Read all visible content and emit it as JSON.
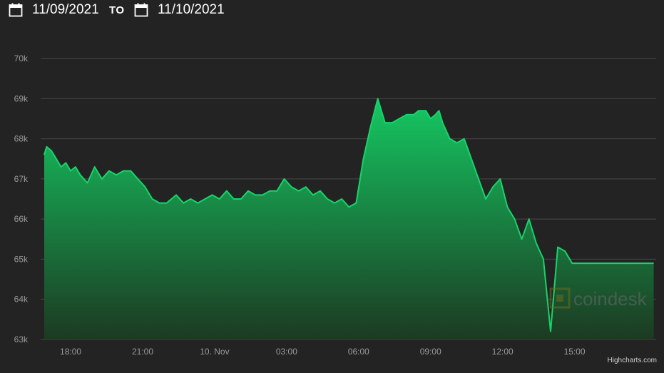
{
  "range": {
    "from": "11/09/2021",
    "separator": "TO",
    "to": "11/10/2021"
  },
  "icons": {
    "calendar": "calendar-icon"
  },
  "colors": {
    "background": "#232323",
    "line": "#18d46a",
    "fill_top": "#15c862",
    "fill_bottom": "#1c3a22",
    "grid": "#4a4a4a",
    "tick": "#9a9a9a",
    "watermark": "#5a5a1a"
  },
  "watermark": "coindesk",
  "credits": "Highcharts.com",
  "chart_data": {
    "type": "area",
    "title": "",
    "xlabel": "",
    "ylabel": "",
    "ylim": [
      63000,
      70000
    ],
    "yticks": [
      63000,
      64000,
      65000,
      66000,
      67000,
      68000,
      69000,
      70000
    ],
    "ytick_labels": [
      "63k",
      "64k",
      "65k",
      "66k",
      "67k",
      "68k",
      "69k",
      "70k"
    ],
    "xticks": [
      18,
      21,
      24,
      27,
      30,
      33,
      36,
      39
    ],
    "xtick_labels": [
      "18:00",
      "21:00",
      "10. Nov",
      "03:00",
      "06:00",
      "09:00",
      "12:00",
      "15:00"
    ],
    "grid": true,
    "legend": "none",
    "series": [
      {
        "x": [
          16.9,
          17.0,
          17.2,
          17.4,
          17.6,
          17.8,
          18.0,
          18.2,
          18.4,
          18.7,
          19.0,
          19.3,
          19.6,
          19.9,
          20.2,
          20.5,
          20.8,
          21.1,
          21.4,
          21.7,
          22.0,
          22.2,
          22.4,
          22.7,
          23.0,
          23.3,
          23.6,
          23.9,
          24.2,
          24.5,
          24.8,
          25.1,
          25.4,
          25.7,
          26.0,
          26.3,
          26.6,
          26.9,
          27.2,
          27.5,
          27.8,
          28.1,
          28.4,
          28.7,
          29.0,
          29.3,
          29.6,
          29.9,
          30.2,
          30.5,
          30.8,
          31.1,
          31.4,
          31.7,
          32.0,
          32.3,
          32.5,
          32.8,
          33.0,
          33.2,
          33.35,
          33.5,
          33.8,
          34.1,
          34.4,
          34.7,
          35.0,
          35.3,
          35.6,
          35.9,
          36.2,
          36.5,
          36.8,
          37.1,
          37.4,
          37.7,
          38.0,
          38.3,
          38.6,
          38.9,
          39.2,
          39.5,
          39.8,
          40.0,
          40.2,
          40.4,
          40.6,
          40.8,
          41.0,
          41.1,
          41.2,
          41.4,
          41.5,
          41.6,
          41.7,
          41.8,
          42.0,
          42.2,
          42.3
        ],
        "y": [
          67600,
          67800,
          67700,
          67500,
          67300,
          67400,
          67200,
          67300,
          67100,
          66900,
          67300,
          67000,
          67200,
          67100,
          67200,
          67200,
          67000,
          66800,
          66500,
          66400,
          66400,
          66500,
          66600,
          66400,
          66500,
          66400,
          66500,
          66600,
          66500,
          66700,
          66500,
          66500,
          66700,
          66600,
          66600,
          66700,
          66700,
          67000,
          66800,
          66700,
          66800,
          66600,
          66700,
          66500,
          66400,
          66500,
          66300,
          66400,
          67500,
          68300,
          69000,
          68400,
          68400,
          68500,
          68600,
          68600,
          68700,
          68700,
          68500,
          68600,
          68700,
          68400,
          68000,
          67900,
          68000,
          67500,
          67000,
          66500,
          66800,
          67000,
          66300,
          66000,
          65500,
          66000,
          65400,
          65000,
          63200,
          65300,
          65200,
          64900,
          64900,
          64900,
          64900,
          64900,
          64900,
          64900,
          64900,
          64900,
          64900,
          64900,
          64900,
          64900,
          64900,
          64900,
          64900,
          64900,
          64900,
          64900,
          64900
        ]
      }
    ]
  }
}
